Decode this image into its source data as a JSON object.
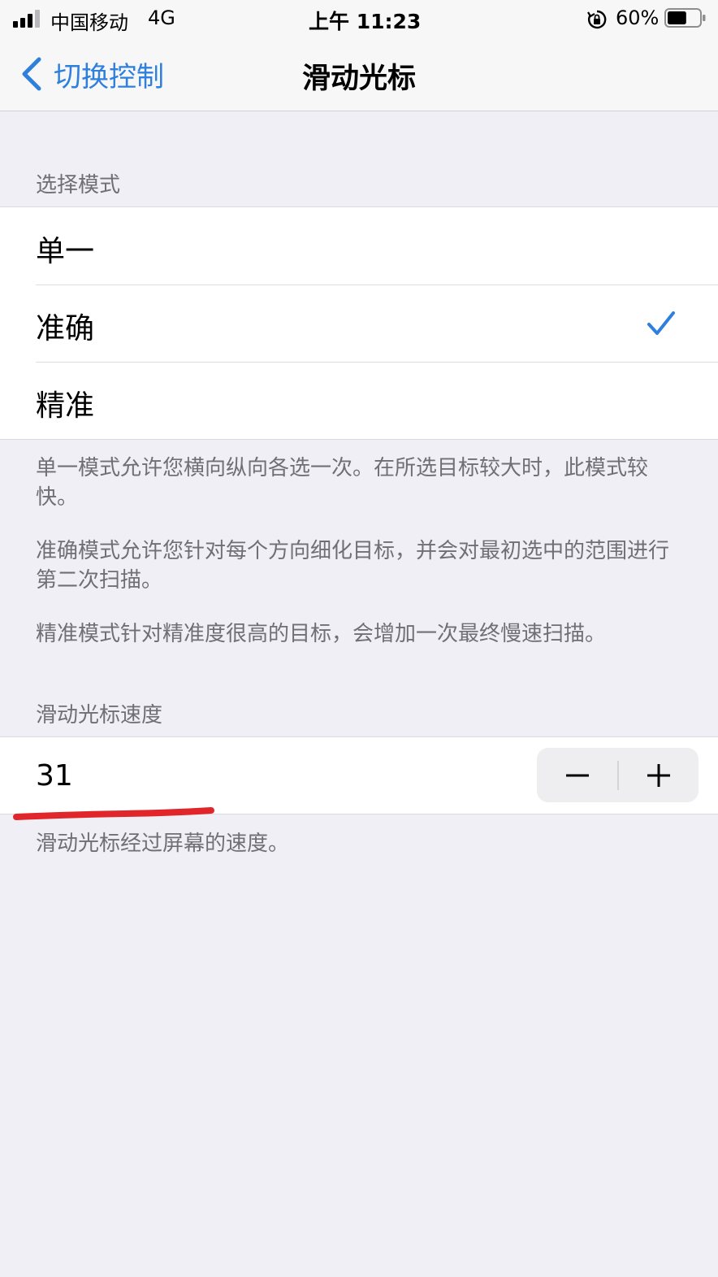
{
  "status_bar": {
    "carrier": "中国移动",
    "network": "4G",
    "time": "上午 11:23",
    "battery": "60%",
    "battery_level": 0.6
  },
  "nav": {
    "back_label": "切换控制",
    "title": "滑动光标"
  },
  "selection_mode": {
    "header": "选择模式",
    "options": [
      {
        "label": "单一",
        "selected": false
      },
      {
        "label": "准确",
        "selected": true
      },
      {
        "label": "精准",
        "selected": false
      }
    ],
    "footer": [
      "单一模式允许您横向纵向各选一次。在所选目标较大时，此模式较快。",
      "准确模式允许您针对每个方向细化目标，并会对最初选中的范围进行第二次扫描。",
      "精准模式针对精准度很高的目标，会增加一次最终慢速扫描。"
    ]
  },
  "speed": {
    "header": "滑动光标速度",
    "value": "31",
    "footer": "滑动光标经过屏幕的速度。"
  },
  "colors": {
    "accent": "#2f7fdc",
    "annotation": "#e0262a",
    "background": "#f0eff5"
  },
  "icons": {
    "back": "chevron-left-icon",
    "selected": "checkmark-icon",
    "decrement": "minus-icon",
    "increment": "plus-icon"
  }
}
